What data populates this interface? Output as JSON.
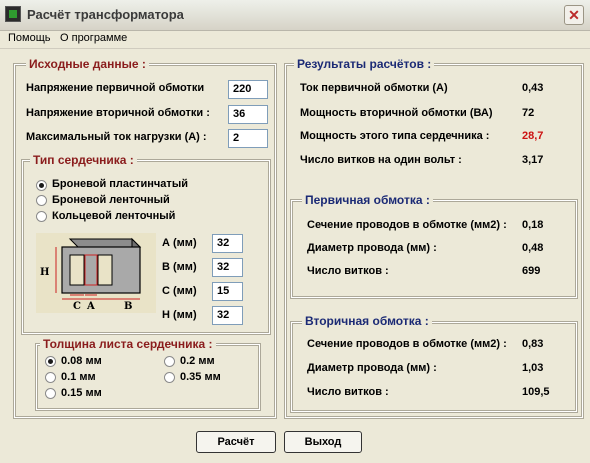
{
  "window": {
    "title": "Расчёт трансформатора"
  },
  "menu": [
    "Помощь",
    "О программе"
  ],
  "input": {
    "title": "Исходные данные :",
    "fields": [
      {
        "label": "Напряжение первичной обмотки",
        "value": "220"
      },
      {
        "label": "Напряжение вторичной обмотки :",
        "value": "36"
      },
      {
        "label": "Максимальный ток нагрузки  (А) :",
        "value": "2"
      }
    ]
  },
  "core": {
    "title": "Тип сердечника :",
    "options": [
      "Броневой пластинчатый",
      "Броневой ленточный",
      "Кольцевой ленточный"
    ],
    "selected": "Броневой пластинчатый",
    "diagram_labels": {
      "h": "H",
      "c": "C",
      "a": "A",
      "b": "B"
    },
    "dims": [
      {
        "label": "А (мм)",
        "value": "32"
      },
      {
        "label": "В (мм)",
        "value": "32"
      },
      {
        "label": "С (мм)",
        "value": "15"
      },
      {
        "label": "Н (мм)",
        "value": "32"
      }
    ]
  },
  "thickness": {
    "title": "Толщина листа сердечника :",
    "options": [
      "0.08 мм",
      "0.1 мм",
      "0.15 мм",
      "0.2 мм",
      "0.35 мм"
    ],
    "selected": "0.08 мм"
  },
  "results": {
    "title": "Результаты расчётов :",
    "rows": [
      {
        "label": "Ток первичной обмотки (А)",
        "value": "0,43"
      },
      {
        "label": "Мощность вторичной обмотки (ВА)",
        "value": "72"
      },
      {
        "label": "Мощность  этого типа сердечника :",
        "value": "28,7"
      },
      {
        "label": "Число витков на один вольт :",
        "value": "3,17"
      }
    ],
    "highlight_color": "#cc1111"
  },
  "primary": {
    "title": "Первичная обмотка :",
    "rows": [
      {
        "label": "Сечение проводов в обмотке (мм2) :",
        "value": "0,18"
      },
      {
        "label": "Диаметр провода (мм) :",
        "value": "0,48"
      },
      {
        "label": "Число витков :",
        "value": "699"
      }
    ]
  },
  "secondary": {
    "title": "Вторичная обмотка :",
    "rows": [
      {
        "label": "Сечение проводов в обмотке (мм2) :",
        "value": "0,83"
      },
      {
        "label": "Диаметр провода (мм) :",
        "value": "1,03"
      },
      {
        "label": "Число витков :",
        "value": "109,5"
      }
    ]
  },
  "buttons": {
    "calc": "Расчёт",
    "exit": "Выход"
  }
}
